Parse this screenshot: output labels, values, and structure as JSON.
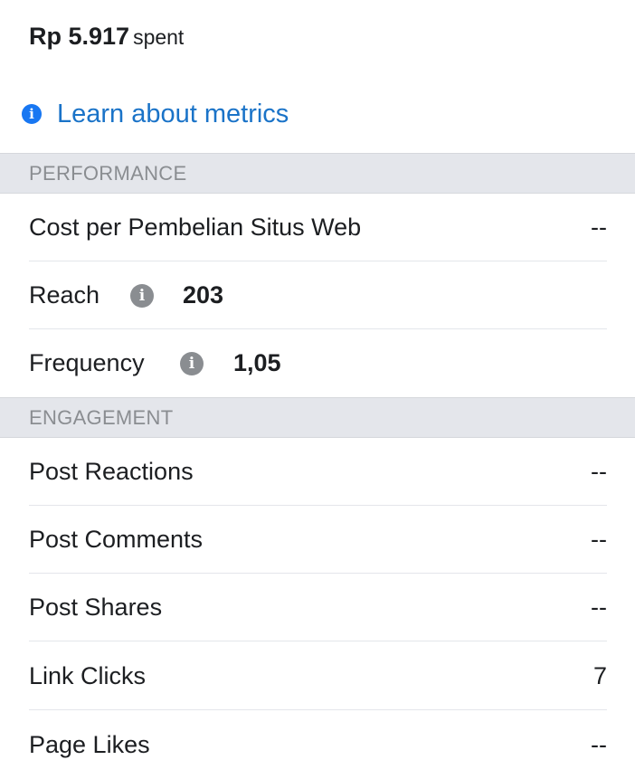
{
  "summary": {
    "amount": "Rp 5.917",
    "suffix": "spent"
  },
  "learn_link": {
    "icon": "info-icon",
    "label": "Learn about metrics"
  },
  "sections": {
    "performance": {
      "title": "PERFORMANCE",
      "rows": [
        {
          "label": "Cost per Pembelian Situs Web",
          "value": "--"
        },
        {
          "label": "Reach",
          "value": "203",
          "info_icon": "info-icon"
        },
        {
          "label": "Frequency",
          "value": "1,05",
          "info_icon": "info-icon"
        }
      ]
    },
    "engagement": {
      "title": "ENGAGEMENT",
      "rows": [
        {
          "label": "Post Reactions",
          "value": "--"
        },
        {
          "label": "Post Comments",
          "value": "--"
        },
        {
          "label": "Post Shares",
          "value": "--"
        },
        {
          "label": "Link Clicks",
          "value": "7"
        },
        {
          "label": "Page Likes",
          "value": "--"
        }
      ]
    }
  },
  "colors": {
    "link_blue": "#1a73c8",
    "info_blue": "#1877f2",
    "info_gray": "#8a8d91",
    "section_bg": "#e4e6eb"
  }
}
